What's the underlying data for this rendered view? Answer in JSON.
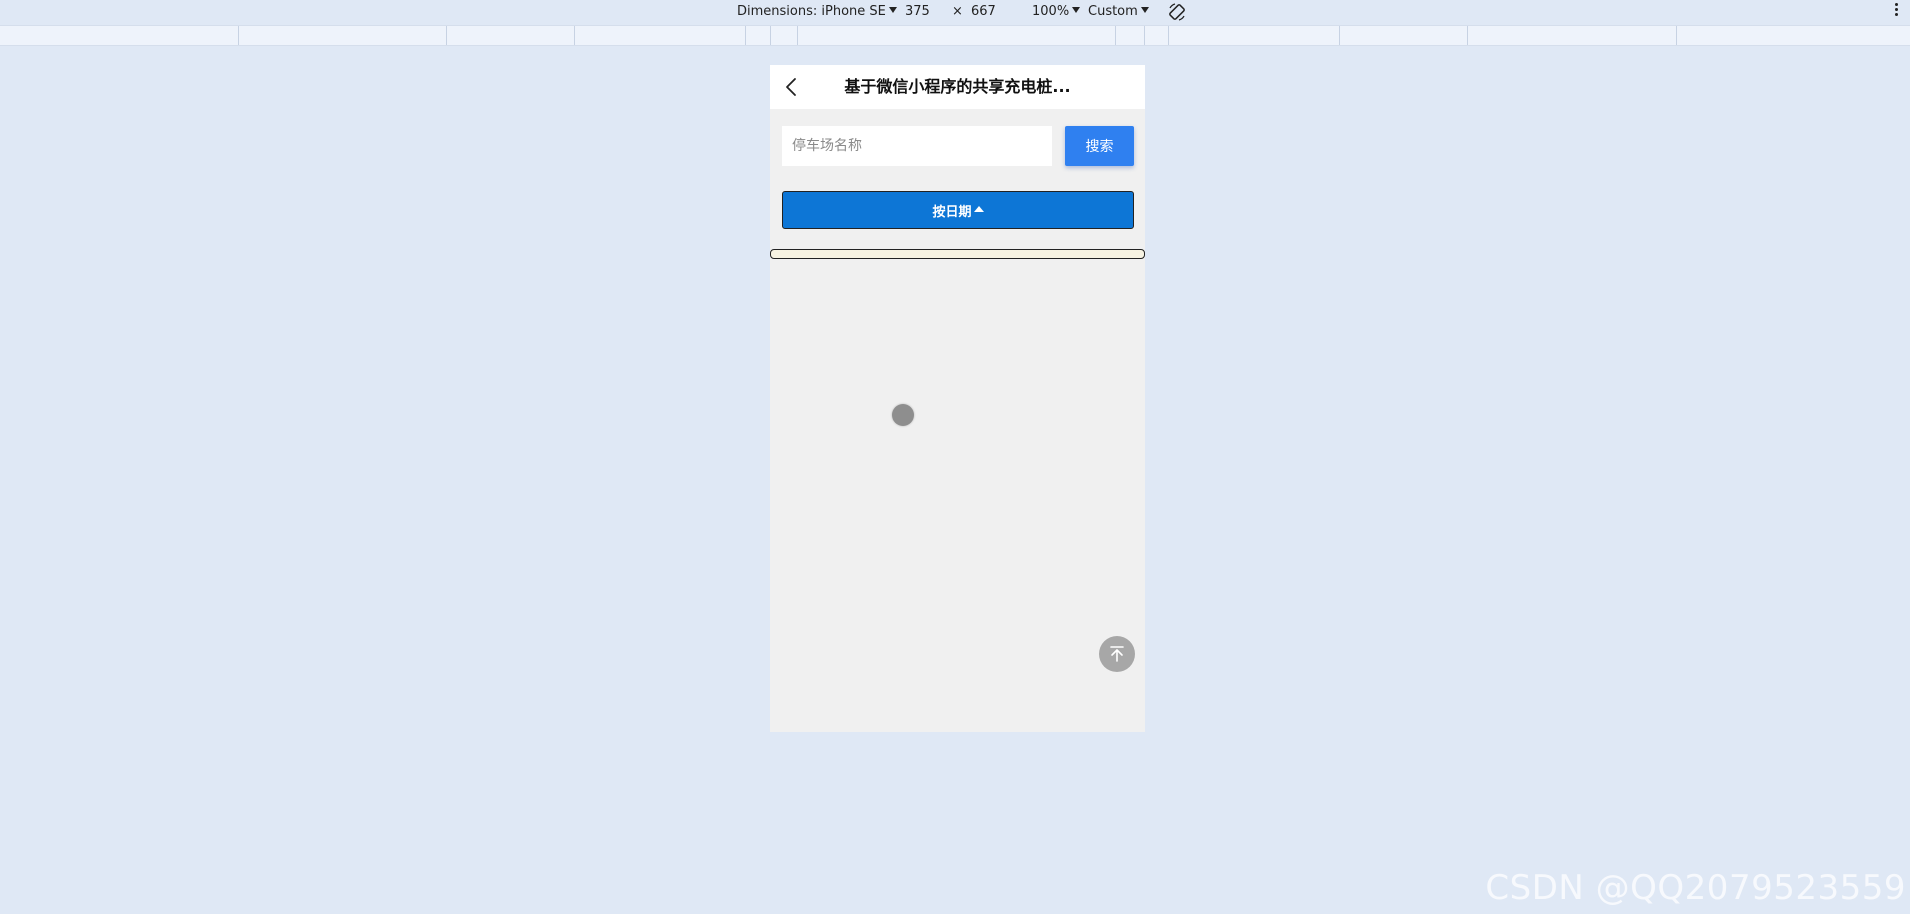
{
  "devtools": {
    "dimensions_label": "Dimensions: iPhone SE",
    "width_value": "375",
    "times_sign": "×",
    "height_value": "667",
    "zoom_label": "100%",
    "throttle_label": "Custom",
    "icons": {
      "dimensions_dropdown": "caret-down-icon",
      "rotate": "rotate-icon",
      "more": "kebab-menu-icon"
    }
  },
  "app": {
    "nav": {
      "back_icon": "chevron-left-icon",
      "title": "基于微信小程序的共享充电桩..."
    },
    "search": {
      "placeholder": "停车场名称",
      "value": "",
      "button_label": "搜索"
    },
    "sort": {
      "label": "按日期",
      "indicator_icon": "triangle-up-icon"
    },
    "back_to_top_icon": "arrow-to-top-icon"
  },
  "watermark": {
    "text": "CSDN @QQ2079523559"
  },
  "colors": {
    "page_background": "#dfe8f5",
    "device_background": "#f0f0f0",
    "search_button": "#2f80f0",
    "sort_button": "#0d76d6",
    "back_to_top": "#a7a7a7"
  }
}
